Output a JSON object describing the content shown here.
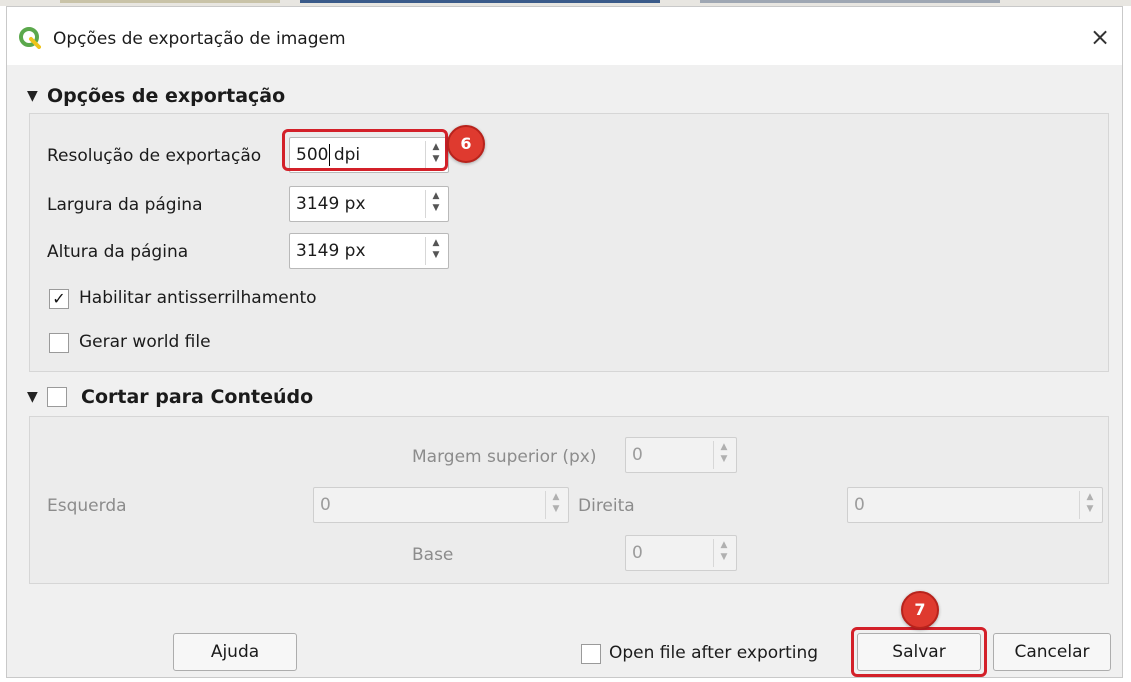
{
  "window": {
    "title": "Opções de exportação de imagem",
    "close_symbol": "×",
    "accent_color": "#5ba84c"
  },
  "export_options": {
    "header": "Opções de exportação",
    "collapse_symbol": "▼",
    "resolution": {
      "label": "Resolução de exportação",
      "value": "500 dpi"
    },
    "page_width": {
      "label": "Largura da página",
      "value": "3149 px"
    },
    "page_height": {
      "label": "Altura da página",
      "value": "3149 px"
    },
    "antialiasing": {
      "label": "Habilitar antisserrilhamento",
      "checked": true,
      "check_symbol": "✓"
    },
    "world_file": {
      "label": "Gerar world file",
      "checked": false
    }
  },
  "crop": {
    "header": "Cortar para Conteúdo",
    "collapse_symbol": "▼",
    "checked": false,
    "top_margin": {
      "label": "Margem superior (px)",
      "value": "0"
    },
    "left": {
      "label": "Esquerda",
      "value": "0"
    },
    "right": {
      "label": "Direita",
      "value": "0"
    },
    "bottom": {
      "label": "Base",
      "value": "0"
    }
  },
  "footer": {
    "help_label": "Ajuda",
    "open_after_label": "Open file after exporting",
    "save_label": "Salvar",
    "cancel_label": "Cancelar"
  },
  "annotations": {
    "step_resolution": "6",
    "step_save": "7",
    "color": "#d32029"
  },
  "spin_arrows": {
    "up": "▲",
    "down": "▼"
  }
}
